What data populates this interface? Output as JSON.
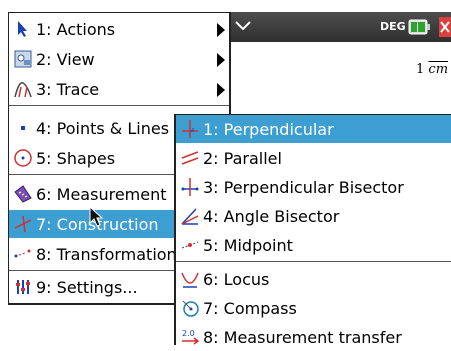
{
  "topbar": {
    "angle_mode": "DEG"
  },
  "canvas": {
    "unit_number": "1",
    "unit_name": "cm"
  },
  "menu": {
    "items": [
      {
        "label": "1: Actions",
        "icon": "arrow-pointer-icon",
        "has_submenu": true
      },
      {
        "label": "2: View",
        "icon": "view-icon",
        "has_submenu": true
      },
      {
        "label": "3: Trace",
        "icon": "trace-icon",
        "has_submenu": true
      },
      {
        "label": "4: Points & Lines",
        "icon": "point-icon",
        "has_submenu": true
      },
      {
        "label": "5: Shapes",
        "icon": "circle-shape-icon",
        "has_submenu": true
      },
      {
        "label": "6: Measurement",
        "icon": "ruler-icon",
        "has_submenu": true
      },
      {
        "label": "7: Construction",
        "icon": "construction-icon",
        "has_submenu": true,
        "selected": true
      },
      {
        "label": "8: Transformation",
        "icon": "transformation-icon",
        "has_submenu": true
      },
      {
        "label": "9: Settings...",
        "icon": "settings-icon",
        "has_submenu": false
      }
    ]
  },
  "submenu": {
    "items": [
      {
        "label": "1: Perpendicular",
        "icon": "perpendicular-icon",
        "selected": true
      },
      {
        "label": "2: Parallel",
        "icon": "parallel-icon"
      },
      {
        "label": "3: Perpendicular Bisector",
        "icon": "perpendicular-bisector-icon"
      },
      {
        "label": "4: Angle Bisector",
        "icon": "angle-bisector-icon"
      },
      {
        "label": "5: Midpoint",
        "icon": "midpoint-icon"
      },
      {
        "label": "6: Locus",
        "icon": "locus-icon"
      },
      {
        "label": "7: Compass",
        "icon": "compass-icon"
      },
      {
        "label": "8: Measurement transfer",
        "icon": "measurement-transfer-icon"
      }
    ]
  },
  "colors": {
    "highlight": "#3d9fd1",
    "topbar": "#3a3a3a"
  }
}
